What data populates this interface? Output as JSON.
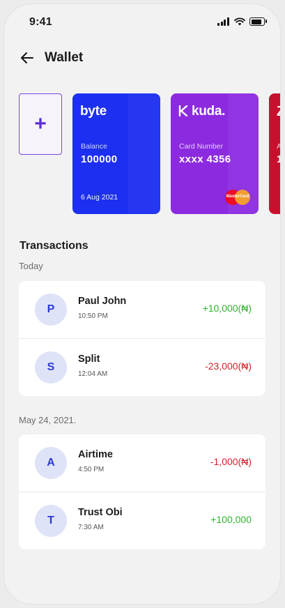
{
  "status_bar": {
    "time": "9:41"
  },
  "header": {
    "title": "Wallet"
  },
  "cards": {
    "add_label": "+",
    "byte": {
      "brand": "byte",
      "label": "Balance",
      "value": "100000",
      "date": "6 Aug 2021"
    },
    "kuda": {
      "brand": "kuda.",
      "label": "Card Number",
      "value": "xxxx 4356",
      "network": "MasterCard"
    },
    "partial": {
      "brand": "Z",
      "label": "A",
      "value": "1"
    }
  },
  "transactions": {
    "title": "Transactions",
    "groups": [
      {
        "label": "Today",
        "items": [
          {
            "initial": "P",
            "name": "Paul John",
            "time": "10:50 PM",
            "amount": "+10,000(₦)"
          },
          {
            "initial": "S",
            "name": "Split",
            "time": "12:04 AM",
            "amount": "-23,000(₦)"
          }
        ]
      },
      {
        "label": "May 24, 2021.",
        "items": [
          {
            "initial": "A",
            "name": "Airtime",
            "time": "4:50 PM",
            "amount": "-1,000(₦)"
          },
          {
            "initial": "T",
            "name": "Trust Obi",
            "time": "7:30 AM",
            "amount": "+100,000"
          }
        ]
      }
    ]
  },
  "colors": {
    "byte_card": "#1d2ff0",
    "kuda_card": "#8c2ae0",
    "positive": "#2cb52c",
    "negative": "#d81e2b",
    "avatar_bg": "#dfe3f8"
  }
}
